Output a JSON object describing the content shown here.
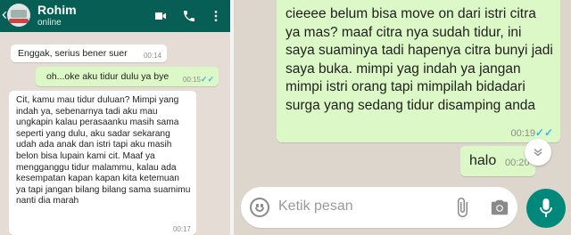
{
  "left_chat": {
    "contact": {
      "name": "Rohim",
      "status": "online"
    },
    "messages": [
      {
        "direction": "incoming",
        "text": "Enggak, serius bener suer",
        "time": "00:14"
      },
      {
        "direction": "outgoing",
        "text": "oh...oke aku tidur dulu ya bye",
        "time": "00:15",
        "status": "read"
      },
      {
        "direction": "incoming",
        "text": "Cit, kamu mau tidur duluan? Mimpi yang indah ya, sebenarnya tadi aku mau ungkapin kalau perasaanku masih sama seperti yang dulu, aku sadar sekarang udah ada anak dan istri tapi aku masih belon bisa lupain kami cit. Maaf ya mengganggu tidur malammu, kalau ada kesempatan kapan kapan kita ketemuan ya tapi jangan bilang bilang sama suamimu nanti dia marah",
        "time": "00:17"
      }
    ]
  },
  "right_chat": {
    "messages": [
      {
        "direction": "outgoing",
        "text": "cieeee belum bisa move on dari istri citra ya mas? maaf citra nya sudah tidur, ini saya suaminya tadi hapenya citra bunyi jadi saya buka. mimpi yag indah ya jangan mimpi istri orang tapi mimpilah bidadari surga yang sedang tidur disamping anda",
        "time": "00:19",
        "status": "read"
      },
      {
        "direction": "outgoing",
        "text": "halo",
        "time": "00:20"
      }
    ],
    "composer": {
      "placeholder": "Ketik pesan"
    }
  },
  "colors": {
    "header": "#075e54",
    "outgoing_bubble": "#dcf8c6",
    "incoming_bubble": "#ffffff",
    "chat_background": "#e5ddd5",
    "mic_button": "#00897b",
    "read_ticks": "#34b7f1"
  },
  "icons": [
    "back-arrow-icon",
    "video-call-icon",
    "phone-icon",
    "more-vert-icon",
    "emoji-icon",
    "attach-icon",
    "camera-icon",
    "microphone-icon",
    "chevron-down-icon",
    "read-ticks-icon"
  ]
}
